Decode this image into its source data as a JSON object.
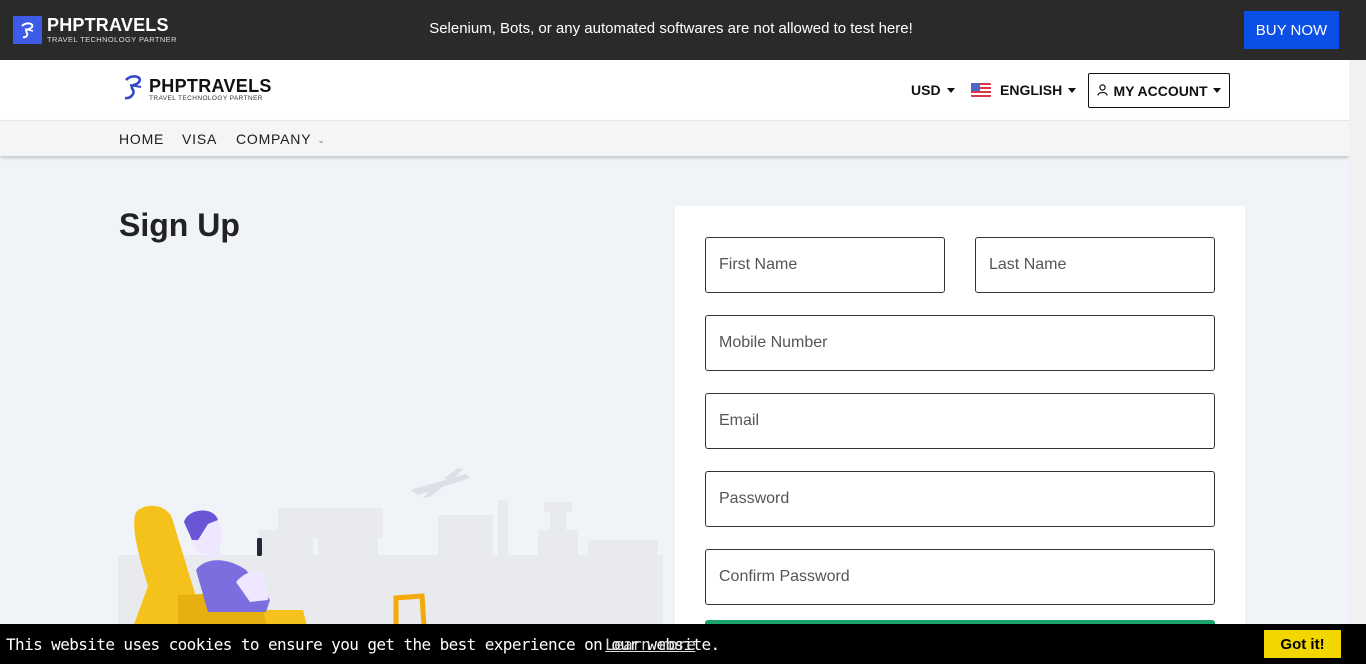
{
  "topbar": {
    "brand": "PHPTRAVELS",
    "tagline": "TRAVEL TECHNOLOGY PARTNER",
    "notice": "Selenium, Bots, or any automated softwares are not allowed to test here!",
    "buy_now": "BUY NOW"
  },
  "header": {
    "brand": "PHPTRAVELS",
    "tagline": "TRAVEL TECHNOLOGY PARTNER",
    "currency": "USD",
    "language": "ENGLISH",
    "account": "MY ACCOUNT"
  },
  "nav": {
    "items": [
      {
        "label": "HOME"
      },
      {
        "label": "VISA"
      },
      {
        "label": "COMPANY"
      }
    ]
  },
  "page": {
    "title": "Sign Up"
  },
  "form": {
    "first_name": "First Name",
    "last_name": "Last Name",
    "mobile": "Mobile Number",
    "email": "Email",
    "password": "Password",
    "confirm_password": "Confirm Password"
  },
  "cookie": {
    "message": "This website uses cookies to ensure you get the best experience on our website.",
    "learn_more": "Learn more",
    "accept": "Got it!"
  },
  "colors": {
    "topbar_bg": "#2a2a2a",
    "buy_now_bg": "#0c4fe6",
    "page_bg": "#f0f3f7",
    "submit_green": "#1aa46b",
    "cookie_button": "#f1d600"
  }
}
